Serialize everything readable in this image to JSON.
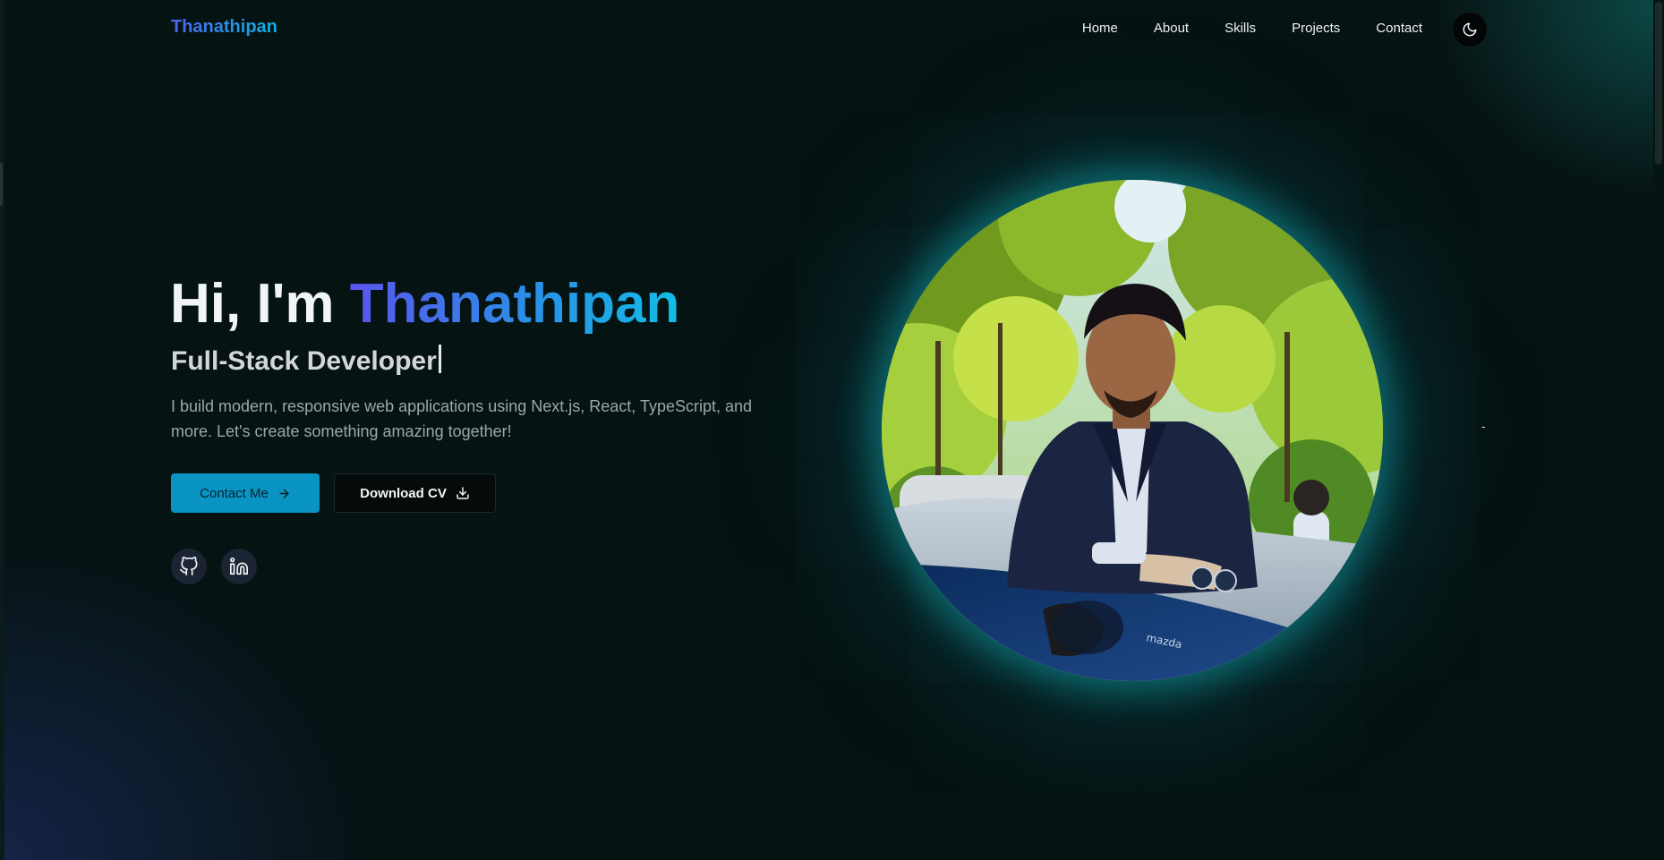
{
  "colors": {
    "background": "#061313",
    "accent": "#0a94c4",
    "gradient_start": "#5a55ee",
    "gradient_end": "#12bde6",
    "glow": "#12a0a8"
  },
  "nav": {
    "logo": "Thanathipan",
    "links": [
      {
        "label": "Home"
      },
      {
        "label": "About"
      },
      {
        "label": "Skills"
      },
      {
        "label": "Projects"
      },
      {
        "label": "Contact"
      }
    ],
    "theme_toggle_icon": "moon-icon"
  },
  "hero": {
    "greeting": "Hi, I'm ",
    "name": "Thanathipan",
    "role": "Full-Stack Developer",
    "description": "I build modern, responsive web applications using Next.js, React, TypeScript, and more. Let's create something amazing together!",
    "contact_button": {
      "label": "Contact Me",
      "icon": "arrow-right-icon"
    },
    "cv_button": {
      "label": "Download CV",
      "icon": "download-icon"
    },
    "socials": [
      {
        "icon": "github-icon"
      },
      {
        "icon": "linkedin-icon"
      }
    ],
    "side_mark": "-"
  }
}
